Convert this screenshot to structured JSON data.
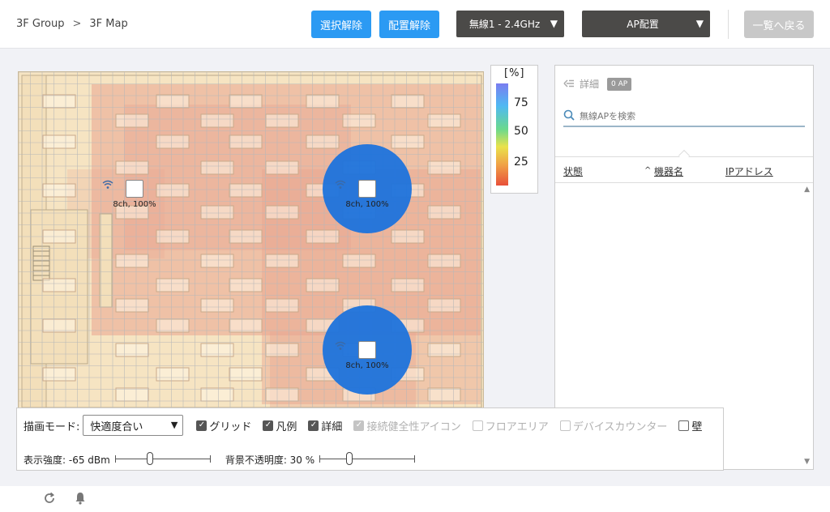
{
  "breadcrumb": {
    "group": "3F Group",
    "separator": ">",
    "map": "3F Map"
  },
  "toolbar_top": {
    "deselect_label": "選択解除",
    "unplace_label": "配置解除",
    "band_select_value": "無線1 - 2.4GHz",
    "ap_place_label": "AP配置",
    "back_to_list_label": "一覧へ戻る"
  },
  "colors": {
    "accent": "#2b9af3",
    "dark_button": "#4b4a48",
    "coverage": "#1e73dc",
    "heat": "#e9a48f"
  },
  "map": {
    "access_points": [
      {
        "label": "8ch, 100%",
        "icon": "wifi-icon",
        "highlighted": false
      },
      {
        "label": "8ch, 100%",
        "icon": "wifi-icon",
        "highlighted": true
      },
      {
        "label": "8ch, 100%",
        "icon": "wifi-icon",
        "highlighted": true
      }
    ]
  },
  "legend": {
    "title": "[%]",
    "ticks": [
      "75",
      "50",
      "25"
    ]
  },
  "side_panel": {
    "detail_label": "詳細",
    "ap_count_badge": "0 AP",
    "search_placeholder": "無線APを検索",
    "columns": {
      "status": "状態",
      "device_name": "機器名",
      "ip_address": "IPアドレス"
    },
    "sort_indicator": "^"
  },
  "bottom_toolbar": {
    "draw_mode_label": "描画モード:",
    "draw_mode_value": "快適度合い",
    "checkboxes": {
      "grid": "グリッド",
      "legend": "凡例",
      "detail": "詳細",
      "health_icon": "接続健全性アイコン",
      "floor_area": "フロアエリア",
      "device_counter": "デバイスカウンター",
      "wall": "壁"
    },
    "checkbox_state": {
      "grid": true,
      "legend": true,
      "detail": true,
      "health_icon": true,
      "floor_area": false,
      "device_counter": false,
      "wall": false
    },
    "signal_strength_label": "表示強度: -65 dBm",
    "signal_strength_level": 0.35,
    "bg_opacity_label": "背景不透明度: 30 %",
    "bg_opacity_level": 0.3
  },
  "footer": {
    "icons": [
      "refresh-icon",
      "bell-icon"
    ]
  }
}
